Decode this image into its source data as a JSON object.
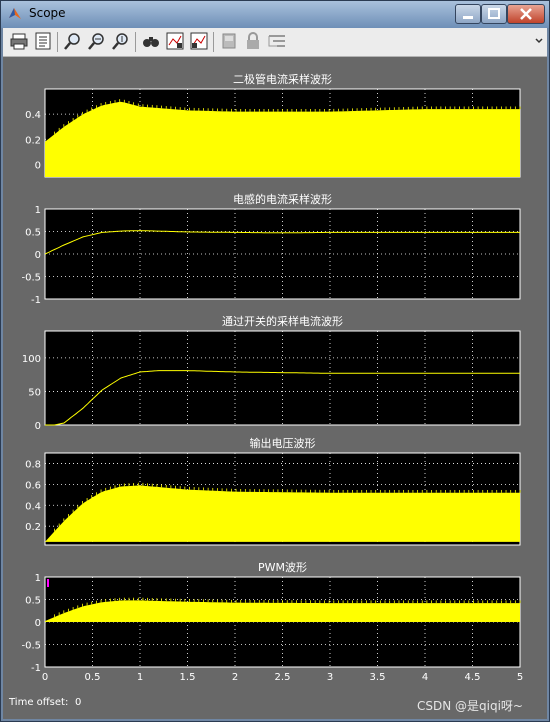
{
  "window": {
    "title": "Scope"
  },
  "toolbar": {
    "icons": [
      "print-icon",
      "parameters-icon",
      "zoom-in-icon",
      "zoom-x-icon",
      "zoom-y-icon",
      "autoscale-icon",
      "save-axes-icon",
      "restore-axes-icon",
      "floating-scope-icon",
      "lock-icon",
      "signal-selection-icon"
    ]
  },
  "colors": {
    "signal": "#ffff00",
    "background": "#000000",
    "frame": "#686868",
    "axis_text": "#ffffff",
    "marker": "#ff00ff"
  },
  "chart_data": [
    {
      "type": "line",
      "title": "二极管电流采样波形",
      "xlim": [
        0,
        5
      ],
      "ylim": [
        -0.1,
        0.6
      ],
      "yticks": [
        "0",
        "0.2",
        "0.4"
      ],
      "xticks": [],
      "series": [
        {
          "x": [
            0,
            0.2,
            0.4,
            0.6,
            0.8,
            1.0,
            1.5,
            2.0,
            3.0,
            4.0,
            5.0
          ],
          "upper": [
            0.18,
            0.3,
            0.4,
            0.47,
            0.5,
            0.46,
            0.43,
            0.42,
            0.42,
            0.44,
            0.44
          ],
          "lower": [
            -0.1,
            -0.1,
            -0.1,
            -0.1,
            -0.1,
            -0.1,
            -0.1,
            -0.1,
            -0.1,
            -0.1,
            -0.1
          ]
        }
      ]
    },
    {
      "type": "line",
      "title": "电感的电流采样波形",
      "xlim": [
        0,
        5
      ],
      "ylim": [
        -1,
        1
      ],
      "yticks": [
        "-1",
        "-0.5",
        "0",
        "0.5",
        "1"
      ],
      "xticks": [],
      "series": [
        {
          "x": [
            0,
            0.2,
            0.4,
            0.6,
            0.8,
            1.0,
            1.5,
            2.0,
            2.5,
            3.0,
            4.0,
            5.0
          ],
          "y": [
            0,
            0.2,
            0.38,
            0.48,
            0.51,
            0.52,
            0.49,
            0.48,
            0.47,
            0.48,
            0.48,
            0.48
          ]
        }
      ]
    },
    {
      "type": "line",
      "title": "通过开关的采样电流波形",
      "xlim": [
        0,
        5
      ],
      "ylim": [
        0,
        140
      ],
      "yticks": [
        "0",
        "50",
        "100"
      ],
      "xticks": [],
      "series": [
        {
          "x": [
            0,
            0.1,
            0.2,
            0.4,
            0.6,
            0.8,
            1.0,
            1.2,
            1.5,
            2.0,
            2.5,
            3.0,
            4.0,
            5.0
          ],
          "y": [
            0,
            0,
            3,
            25,
            52,
            70,
            79,
            81,
            81,
            79,
            78,
            77,
            77,
            77
          ]
        }
      ]
    },
    {
      "type": "line",
      "title": "输出电压波形",
      "xlim": [
        0,
        5
      ],
      "ylim": [
        0.02,
        0.9
      ],
      "yticks": [
        "0.2",
        "0.4",
        "0.6",
        "0.8"
      ],
      "xticks": [],
      "series": [
        {
          "x": [
            0,
            0.2,
            0.4,
            0.6,
            0.8,
            1.0,
            1.5,
            2.0,
            3.0,
            4.0,
            5.0
          ],
          "upper": [
            0.05,
            0.25,
            0.42,
            0.53,
            0.58,
            0.59,
            0.55,
            0.53,
            0.52,
            0.52,
            0.52
          ],
          "lower": [
            0.05,
            0.05,
            0.05,
            0.05,
            0.05,
            0.05,
            0.05,
            0.05,
            0.05,
            0.05,
            0.05
          ]
        }
      ]
    },
    {
      "type": "line",
      "title": "PWM波形",
      "xlim": [
        0,
        5
      ],
      "ylim": [
        -1,
        1
      ],
      "yticks": [
        "-1",
        "-0.5",
        "0",
        "0.5",
        "1"
      ],
      "xticks": [
        "0",
        "0.5",
        "1",
        "1.5",
        "2",
        "2.5",
        "3",
        "3.5",
        "4",
        "4.5",
        "5"
      ],
      "series": [
        {
          "x": [
            0,
            0.2,
            0.4,
            0.6,
            0.8,
            1.0,
            1.5,
            2.0,
            3.0,
            4.0,
            5.0
          ],
          "upper": [
            0.02,
            0.2,
            0.35,
            0.44,
            0.48,
            0.48,
            0.45,
            0.43,
            0.42,
            0.42,
            0.42
          ],
          "lower": [
            0,
            0,
            0,
            0,
            0,
            0,
            0,
            0,
            0,
            0,
            0
          ]
        }
      ]
    }
  ],
  "footer": {
    "time_offset_label": "Time offset:",
    "time_offset_value": "0",
    "watermark": "CSDN @是qiqi呀~"
  }
}
